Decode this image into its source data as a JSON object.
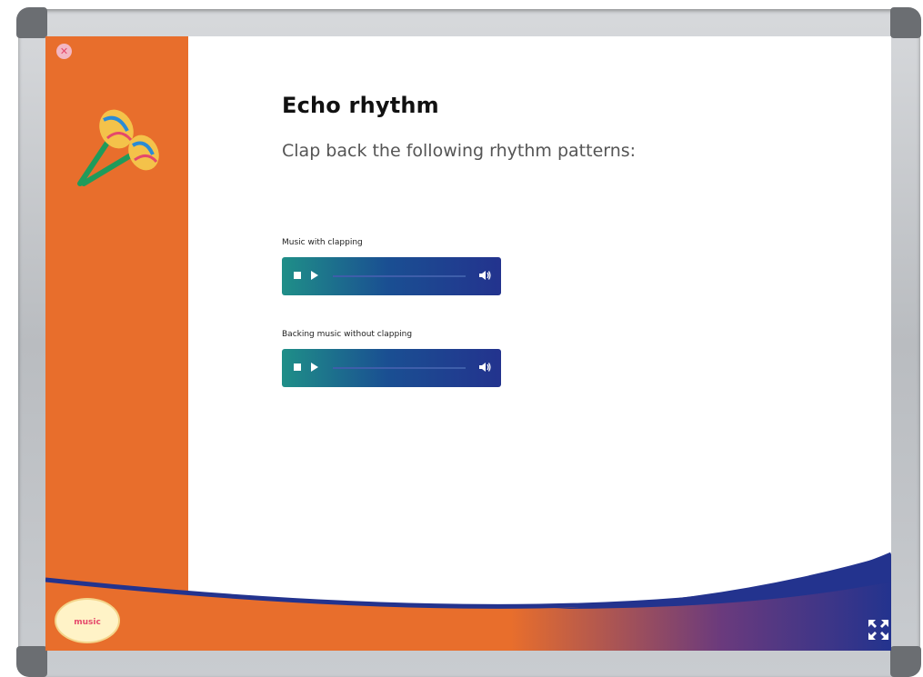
{
  "lesson": {
    "title": "Echo rhythm",
    "instruction": "Clap back the following rhythm patterns:"
  },
  "audio": [
    {
      "label": "Music with clapping"
    },
    {
      "label": "Backing music without clapping"
    }
  ],
  "logo": {
    "text": "music"
  },
  "icons": {
    "close": "close-icon",
    "maracas": "maracas-icon",
    "stop": "stop-icon",
    "play": "play-icon",
    "volume": "volume-icon",
    "fullscreen": "fullscreen-icon"
  },
  "colors": {
    "sidebar": "#e86e2c",
    "player_start": "#1f8f88",
    "player_end": "#23338e",
    "wave": "#23338e"
  }
}
